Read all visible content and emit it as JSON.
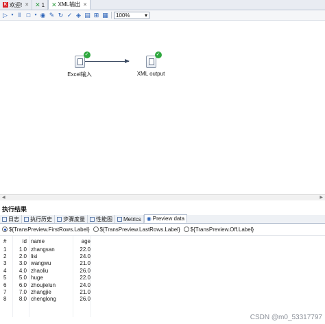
{
  "tabs": [
    {
      "label": "欢迎!",
      "icon": "kettle-logo-icon"
    },
    {
      "label": "1",
      "icon": "transformation-icon"
    },
    {
      "label": "XML输出",
      "icon": "transformation-icon",
      "active": true
    }
  ],
  "toolbar": {
    "zoom": "100%"
  },
  "canvas": {
    "steps": [
      {
        "label": "Excel输入",
        "icon": "excel-input-icon"
      },
      {
        "label": "XML output",
        "icon": "xml-output-icon"
      }
    ]
  },
  "results": {
    "title": "执行结果",
    "tabs": [
      "日志",
      "执行历史",
      "步骤度量",
      "性能图",
      "Metrics",
      "Preview data"
    ],
    "radios": [
      "${TransPreview.FirstRows.Label}",
      "${TransPreview.LastRows.Label}",
      "${TransPreview.Off.Label}"
    ],
    "columns": [
      "#",
      "id",
      "name",
      "age"
    ],
    "rows": [
      [
        "1",
        "1.0",
        "zhangsan",
        "22.0"
      ],
      [
        "2",
        "2.0",
        "lisi",
        "24.0"
      ],
      [
        "3",
        "3.0",
        "wangwu",
        "21.0"
      ],
      [
        "4",
        "4.0",
        "zhaoliu",
        "26.0"
      ],
      [
        "5",
        "5.0",
        "huge",
        "22.0"
      ],
      [
        "6",
        "6.0",
        "zhoujielun",
        "24.0"
      ],
      [
        "7",
        "7.0",
        "zhangjie",
        "21.0"
      ],
      [
        "8",
        "8.0",
        "chenglong",
        "26.0"
      ]
    ]
  },
  "watermark": "CSDN @m0_53317797",
  "colors": {
    "accent": "#2a62b8",
    "ok_badge": "#2fa83f",
    "hop": "#3c4a62"
  }
}
